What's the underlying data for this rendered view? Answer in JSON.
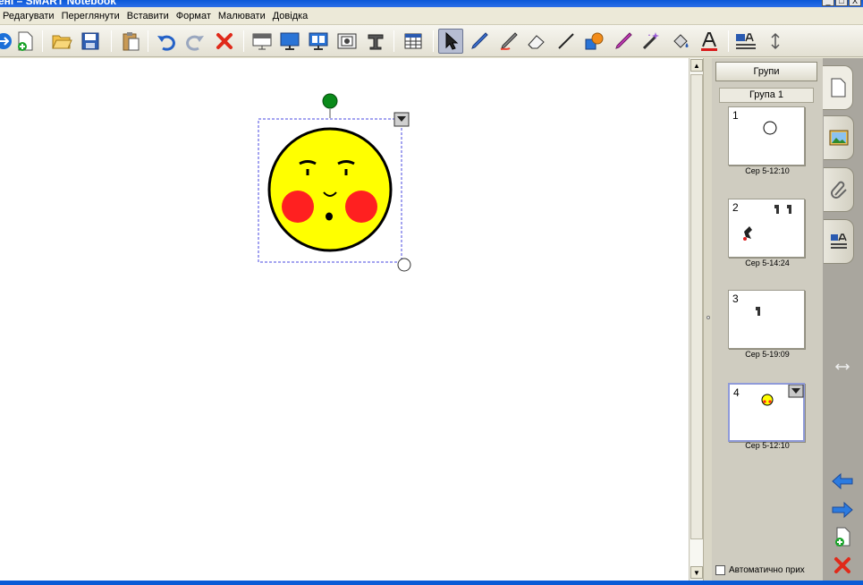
{
  "window": {
    "title": "ені – SMART Notebook",
    "controls": [
      "_",
      "□",
      "X"
    ]
  },
  "menu": [
    {
      "label": "Редагувати"
    },
    {
      "label": "Переглянути"
    },
    {
      "label": "Вставити"
    },
    {
      "label": "Формат"
    },
    {
      "label": "Малювати"
    },
    {
      "label": "Довідка"
    }
  ],
  "toolbar": {
    "icons": [
      "forward-icon",
      "add-page-icon",
      "open-folder-icon",
      "save-icon",
      "paste-icon",
      "undo-icon",
      "redo-icon",
      "delete-icon",
      "screen-shade-icon",
      "full-screen-icon",
      "dual-page-icon",
      "screen-capture-icon",
      "document-camera-icon",
      "table-icon",
      "select-icon",
      "pen-icon",
      "creative-pen-icon",
      "eraser-icon",
      "line-icon",
      "shapes-icon",
      "magic-pen-icon",
      "magic-wand-icon",
      "fill-icon",
      "text-icon",
      "properties-icon",
      "move-toolbar-icon"
    ]
  },
  "canvas": {
    "object": "smiley-face",
    "object_menu_icon": "dropdown-arrow-icon"
  },
  "side_panel": {
    "groups_button": "Групи",
    "group_label": "Група 1",
    "pages": [
      {
        "num": "1",
        "time": "Сер 5-12:10"
      },
      {
        "num": "2",
        "time": "Сер 5-14:24"
      },
      {
        "num": "3",
        "time": "Сер 5-19:09"
      },
      {
        "num": "4",
        "time": "Сер 5-12:10"
      }
    ],
    "autohide_label": "Автоматично прих"
  },
  "colors": {
    "accent": "#0a58d8",
    "face_fill": "#ffff00",
    "cheek": "#ff2020",
    "rotate_handle": "#0a8a1a"
  }
}
